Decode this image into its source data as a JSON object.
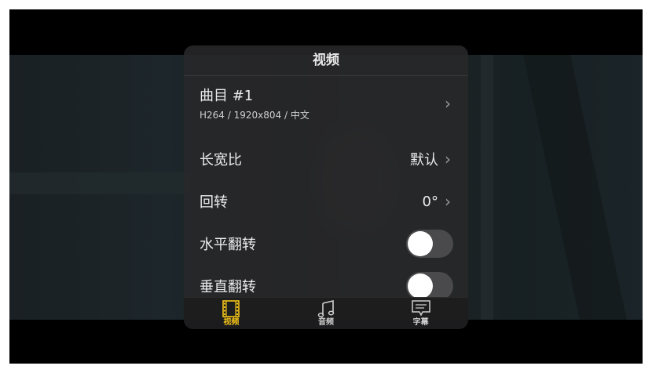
{
  "panel": {
    "title": "视频"
  },
  "track": {
    "label": "曲目 #1",
    "detail": "H264 / 1920x804 / 中文"
  },
  "aspect": {
    "label": "长宽比",
    "value": "默认"
  },
  "rotate": {
    "label": "回转",
    "value": "0°"
  },
  "hflip": {
    "label": "水平翻转",
    "on": false
  },
  "vflip": {
    "label": "垂直翻转",
    "on": false
  },
  "tabs": [
    {
      "label": "视频",
      "icon": "film-icon",
      "active": true
    },
    {
      "label": "音频",
      "icon": "music-note-icon",
      "active": false
    },
    {
      "label": "字幕",
      "icon": "subtitle-icon",
      "active": false
    }
  ],
  "colors": {
    "accent": "#f5c518",
    "panel_bg": "#28282a",
    "toggle_off": "#4a4a4c"
  }
}
